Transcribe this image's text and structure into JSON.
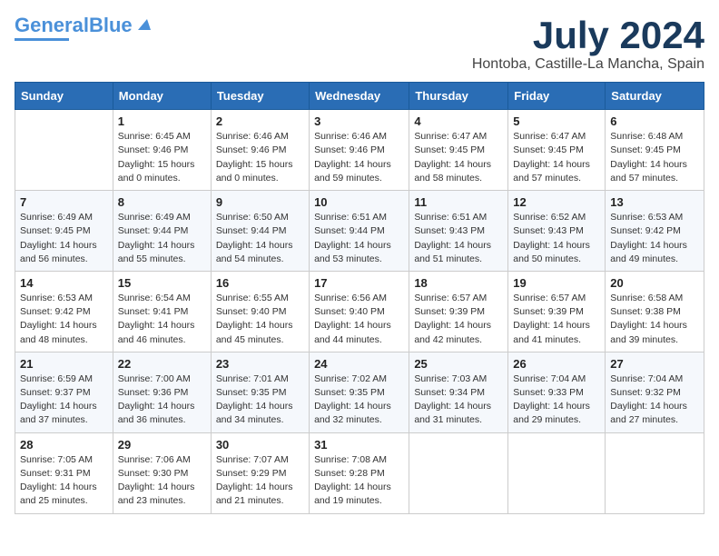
{
  "header": {
    "logo_general": "General",
    "logo_blue": "Blue",
    "month_title": "July 2024",
    "location": "Hontoba, Castille-La Mancha, Spain"
  },
  "days_of_week": [
    "Sunday",
    "Monday",
    "Tuesday",
    "Wednesday",
    "Thursday",
    "Friday",
    "Saturday"
  ],
  "weeks": [
    [
      {
        "day": "",
        "sunrise": "",
        "sunset": "",
        "daylight": ""
      },
      {
        "day": "1",
        "sunrise": "Sunrise: 6:45 AM",
        "sunset": "Sunset: 9:46 PM",
        "daylight": "Daylight: 15 hours and 0 minutes."
      },
      {
        "day": "2",
        "sunrise": "Sunrise: 6:46 AM",
        "sunset": "Sunset: 9:46 PM",
        "daylight": "Daylight: 15 hours and 0 minutes."
      },
      {
        "day": "3",
        "sunrise": "Sunrise: 6:46 AM",
        "sunset": "Sunset: 9:46 PM",
        "daylight": "Daylight: 14 hours and 59 minutes."
      },
      {
        "day": "4",
        "sunrise": "Sunrise: 6:47 AM",
        "sunset": "Sunset: 9:45 PM",
        "daylight": "Daylight: 14 hours and 58 minutes."
      },
      {
        "day": "5",
        "sunrise": "Sunrise: 6:47 AM",
        "sunset": "Sunset: 9:45 PM",
        "daylight": "Daylight: 14 hours and 57 minutes."
      },
      {
        "day": "6",
        "sunrise": "Sunrise: 6:48 AM",
        "sunset": "Sunset: 9:45 PM",
        "daylight": "Daylight: 14 hours and 57 minutes."
      }
    ],
    [
      {
        "day": "7",
        "sunrise": "Sunrise: 6:49 AM",
        "sunset": "Sunset: 9:45 PM",
        "daylight": "Daylight: 14 hours and 56 minutes."
      },
      {
        "day": "8",
        "sunrise": "Sunrise: 6:49 AM",
        "sunset": "Sunset: 9:44 PM",
        "daylight": "Daylight: 14 hours and 55 minutes."
      },
      {
        "day": "9",
        "sunrise": "Sunrise: 6:50 AM",
        "sunset": "Sunset: 9:44 PM",
        "daylight": "Daylight: 14 hours and 54 minutes."
      },
      {
        "day": "10",
        "sunrise": "Sunrise: 6:51 AM",
        "sunset": "Sunset: 9:44 PM",
        "daylight": "Daylight: 14 hours and 53 minutes."
      },
      {
        "day": "11",
        "sunrise": "Sunrise: 6:51 AM",
        "sunset": "Sunset: 9:43 PM",
        "daylight": "Daylight: 14 hours and 51 minutes."
      },
      {
        "day": "12",
        "sunrise": "Sunrise: 6:52 AM",
        "sunset": "Sunset: 9:43 PM",
        "daylight": "Daylight: 14 hours and 50 minutes."
      },
      {
        "day": "13",
        "sunrise": "Sunrise: 6:53 AM",
        "sunset": "Sunset: 9:42 PM",
        "daylight": "Daylight: 14 hours and 49 minutes."
      }
    ],
    [
      {
        "day": "14",
        "sunrise": "Sunrise: 6:53 AM",
        "sunset": "Sunset: 9:42 PM",
        "daylight": "Daylight: 14 hours and 48 minutes."
      },
      {
        "day": "15",
        "sunrise": "Sunrise: 6:54 AM",
        "sunset": "Sunset: 9:41 PM",
        "daylight": "Daylight: 14 hours and 46 minutes."
      },
      {
        "day": "16",
        "sunrise": "Sunrise: 6:55 AM",
        "sunset": "Sunset: 9:40 PM",
        "daylight": "Daylight: 14 hours and 45 minutes."
      },
      {
        "day": "17",
        "sunrise": "Sunrise: 6:56 AM",
        "sunset": "Sunset: 9:40 PM",
        "daylight": "Daylight: 14 hours and 44 minutes."
      },
      {
        "day": "18",
        "sunrise": "Sunrise: 6:57 AM",
        "sunset": "Sunset: 9:39 PM",
        "daylight": "Daylight: 14 hours and 42 minutes."
      },
      {
        "day": "19",
        "sunrise": "Sunrise: 6:57 AM",
        "sunset": "Sunset: 9:39 PM",
        "daylight": "Daylight: 14 hours and 41 minutes."
      },
      {
        "day": "20",
        "sunrise": "Sunrise: 6:58 AM",
        "sunset": "Sunset: 9:38 PM",
        "daylight": "Daylight: 14 hours and 39 minutes."
      }
    ],
    [
      {
        "day": "21",
        "sunrise": "Sunrise: 6:59 AM",
        "sunset": "Sunset: 9:37 PM",
        "daylight": "Daylight: 14 hours and 37 minutes."
      },
      {
        "day": "22",
        "sunrise": "Sunrise: 7:00 AM",
        "sunset": "Sunset: 9:36 PM",
        "daylight": "Daylight: 14 hours and 36 minutes."
      },
      {
        "day": "23",
        "sunrise": "Sunrise: 7:01 AM",
        "sunset": "Sunset: 9:35 PM",
        "daylight": "Daylight: 14 hours and 34 minutes."
      },
      {
        "day": "24",
        "sunrise": "Sunrise: 7:02 AM",
        "sunset": "Sunset: 9:35 PM",
        "daylight": "Daylight: 14 hours and 32 minutes."
      },
      {
        "day": "25",
        "sunrise": "Sunrise: 7:03 AM",
        "sunset": "Sunset: 9:34 PM",
        "daylight": "Daylight: 14 hours and 31 minutes."
      },
      {
        "day": "26",
        "sunrise": "Sunrise: 7:04 AM",
        "sunset": "Sunset: 9:33 PM",
        "daylight": "Daylight: 14 hours and 29 minutes."
      },
      {
        "day": "27",
        "sunrise": "Sunrise: 7:04 AM",
        "sunset": "Sunset: 9:32 PM",
        "daylight": "Daylight: 14 hours and 27 minutes."
      }
    ],
    [
      {
        "day": "28",
        "sunrise": "Sunrise: 7:05 AM",
        "sunset": "Sunset: 9:31 PM",
        "daylight": "Daylight: 14 hours and 25 minutes."
      },
      {
        "day": "29",
        "sunrise": "Sunrise: 7:06 AM",
        "sunset": "Sunset: 9:30 PM",
        "daylight": "Daylight: 14 hours and 23 minutes."
      },
      {
        "day": "30",
        "sunrise": "Sunrise: 7:07 AM",
        "sunset": "Sunset: 9:29 PM",
        "daylight": "Daylight: 14 hours and 21 minutes."
      },
      {
        "day": "31",
        "sunrise": "Sunrise: 7:08 AM",
        "sunset": "Sunset: 9:28 PM",
        "daylight": "Daylight: 14 hours and 19 minutes."
      },
      {
        "day": "",
        "sunrise": "",
        "sunset": "",
        "daylight": ""
      },
      {
        "day": "",
        "sunrise": "",
        "sunset": "",
        "daylight": ""
      },
      {
        "day": "",
        "sunrise": "",
        "sunset": "",
        "daylight": ""
      }
    ]
  ]
}
